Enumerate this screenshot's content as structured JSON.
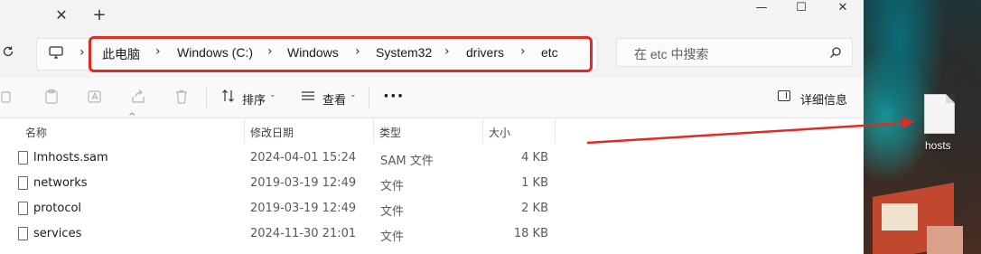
{
  "window": {
    "controls": {
      "minimize": "—",
      "maximize": "☐",
      "close": "✕"
    }
  },
  "tabs": {
    "close_glyph": "✕",
    "add_glyph": "+"
  },
  "breadcrumb": {
    "items": [
      "此电脑",
      "Windows (C:)",
      "Windows",
      "System32",
      "drivers",
      "etc"
    ],
    "separator": "›",
    "highlight_color": "#e02a24"
  },
  "search": {
    "placeholder": "在 etc 中搜索"
  },
  "toolbar": {
    "sort_label": "排序",
    "view_label": "查看",
    "more_label": "···",
    "details_label": "详细信息"
  },
  "columns": [
    "名称",
    "修改日期",
    "类型",
    "大小"
  ],
  "files": [
    {
      "name": "lmhosts.sam",
      "modified": "2024-04-01 15:24",
      "type": "SAM 文件",
      "size": "4 KB"
    },
    {
      "name": "networks",
      "modified": "2019-03-19 12:49",
      "type": "文件",
      "size": "1 KB"
    },
    {
      "name": "protocol",
      "modified": "2019-03-19 12:49",
      "type": "文件",
      "size": "2 KB"
    },
    {
      "name": "services",
      "modified": "2024-11-30 21:01",
      "type": "文件",
      "size": "18 KB"
    }
  ],
  "desktop": {
    "file_label": "hosts"
  },
  "annotation": {
    "arrow_color": "#e02a24"
  }
}
